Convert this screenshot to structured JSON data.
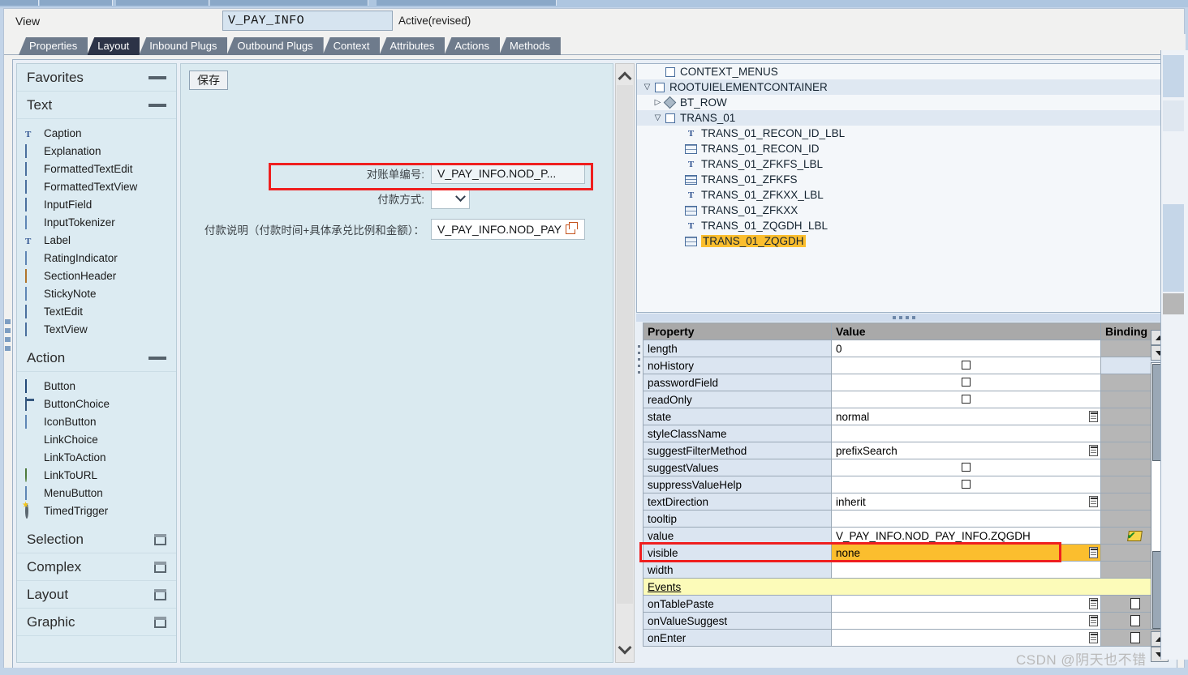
{
  "header": {
    "object_type_label": "View",
    "object_name": "V_PAY_INFO",
    "status": "Active(revised)"
  },
  "tabs": [
    {
      "label": "Properties",
      "active": false
    },
    {
      "label": "Layout",
      "active": true
    },
    {
      "label": "Inbound Plugs",
      "active": false
    },
    {
      "label": "Outbound Plugs",
      "active": false
    },
    {
      "label": "Context",
      "active": false
    },
    {
      "label": "Attributes",
      "active": false
    },
    {
      "label": "Actions",
      "active": false
    },
    {
      "label": "Methods",
      "active": false
    }
  ],
  "palette": {
    "groups": [
      {
        "title": "Favorites",
        "collapsed": false,
        "toggle": "dash",
        "items": []
      },
      {
        "title": "Text",
        "collapsed": false,
        "toggle": "dash",
        "items": [
          {
            "label": "Caption",
            "icon": "text-T-icon"
          },
          {
            "label": "Explanation",
            "icon": "explanation-icon"
          },
          {
            "label": "FormattedTextEdit",
            "icon": "formatted-text-edit-icon"
          },
          {
            "label": "FormattedTextView",
            "icon": "formatted-text-view-icon"
          },
          {
            "label": "InputField",
            "icon": "input-field-icon"
          },
          {
            "label": "InputTokenizer",
            "icon": "input-tokenizer-icon"
          },
          {
            "label": "Label",
            "icon": "label-T-icon"
          },
          {
            "label": "RatingIndicator",
            "icon": "rating-indicator-icon"
          },
          {
            "label": "SectionHeader",
            "icon": "section-header-icon"
          },
          {
            "label": "StickyNote",
            "icon": "sticky-note-icon"
          },
          {
            "label": "TextEdit",
            "icon": "text-edit-icon"
          },
          {
            "label": "TextView",
            "icon": "text-view-icon"
          }
        ]
      },
      {
        "title": "Action",
        "collapsed": false,
        "toggle": "dash",
        "items": [
          {
            "label": "Button",
            "icon": "button-icon"
          },
          {
            "label": "ButtonChoice",
            "icon": "button-choice-icon"
          },
          {
            "label": "IconButton",
            "icon": "icon-button-icon"
          },
          {
            "label": "LinkChoice",
            "icon": "link-choice-icon"
          },
          {
            "label": "LinkToAction",
            "icon": "link-to-action-icon"
          },
          {
            "label": "LinkToURL",
            "icon": "link-to-url-icon"
          },
          {
            "label": "MenuButton",
            "icon": "menu-button-icon"
          },
          {
            "label": "TimedTrigger",
            "icon": "timed-trigger-icon"
          }
        ]
      },
      {
        "title": "Selection",
        "collapsed": true,
        "toggle": "box",
        "items": []
      },
      {
        "title": "Complex",
        "collapsed": true,
        "toggle": "box",
        "items": []
      },
      {
        "title": "Layout",
        "collapsed": true,
        "toggle": "box",
        "items": []
      },
      {
        "title": "Graphic",
        "collapsed": true,
        "toggle": "box",
        "items": []
      }
    ]
  },
  "canvas": {
    "save_button": "保存",
    "fields": [
      {
        "label": "对账单编号:",
        "value": "V_PAY_INFO.NOD_P...",
        "type": "input"
      },
      {
        "label": "付款方式:",
        "value": "",
        "type": "dropdown"
      },
      {
        "label": "付款说明（付款时间+具体承兑比例和金额）：",
        "value": "V_PAY_INFO.NOD_PAY",
        "type": "input-with-help"
      }
    ]
  },
  "tree": {
    "nodes": [
      {
        "label": "CONTEXT_MENUS",
        "indent": 1,
        "twisty": "",
        "icon": "box-icon",
        "selected": false,
        "alt": false
      },
      {
        "label": "ROOTUIELEMENTCONTAINER",
        "indent": 0,
        "twisty": "▽",
        "icon": "box-icon",
        "selected": false,
        "alt": true
      },
      {
        "label": "BT_ROW",
        "indent": 1,
        "twisty": "▷",
        "icon": "diamond-icon",
        "selected": false,
        "alt": false
      },
      {
        "label": "TRANS_01",
        "indent": 1,
        "twisty": "▽",
        "icon": "box-icon",
        "selected": false,
        "alt": true
      },
      {
        "label": "TRANS_01_RECON_ID_LBL",
        "indent": 3,
        "twisty": "",
        "icon": "label-T-icon",
        "selected": false,
        "alt": false
      },
      {
        "label": "TRANS_01_RECON_ID",
        "indent": 3,
        "twisty": "",
        "icon": "input-field-icon",
        "selected": false,
        "alt": false
      },
      {
        "label": "TRANS_01_ZFKFS_LBL",
        "indent": 3,
        "twisty": "",
        "icon": "label-T-icon",
        "selected": false,
        "alt": false
      },
      {
        "label": "TRANS_01_ZFKFS",
        "indent": 3,
        "twisty": "",
        "icon": "dropdown-field-icon",
        "selected": false,
        "alt": false
      },
      {
        "label": "TRANS_01_ZFKXX_LBL",
        "indent": 3,
        "twisty": "",
        "icon": "label-T-icon",
        "selected": false,
        "alt": false
      },
      {
        "label": "TRANS_01_ZFKXX",
        "indent": 3,
        "twisty": "",
        "icon": "input-field-icon",
        "selected": false,
        "alt": false
      },
      {
        "label": "TRANS_01_ZQGDH_LBL",
        "indent": 3,
        "twisty": "",
        "icon": "label-T-icon",
        "selected": false,
        "alt": false
      },
      {
        "label": "TRANS_01_ZQGDH",
        "indent": 3,
        "twisty": "",
        "icon": "input-field-icon",
        "selected": true,
        "alt": false
      }
    ]
  },
  "properties": {
    "columns": [
      "Property",
      "Value",
      "Binding"
    ],
    "rows": [
      {
        "name": "length",
        "value": "0",
        "kind": "text",
        "binding": "filled",
        "valuehelp": false
      },
      {
        "name": "noHistory",
        "value": "",
        "kind": "checkbox",
        "binding": "empty",
        "valuehelp": false
      },
      {
        "name": "passwordField",
        "value": "",
        "kind": "checkbox",
        "binding": "filled",
        "valuehelp": false
      },
      {
        "name": "readOnly",
        "value": "",
        "kind": "checkbox",
        "binding": "filled",
        "valuehelp": false
      },
      {
        "name": "state",
        "value": "normal",
        "kind": "text",
        "binding": "filled",
        "valuehelp": true
      },
      {
        "name": "styleClassName",
        "value": "",
        "kind": "text",
        "binding": "filled",
        "valuehelp": false
      },
      {
        "name": "suggestFilterMethod",
        "value": "prefixSearch",
        "kind": "text",
        "binding": "filled",
        "valuehelp": true
      },
      {
        "name": "suggestValues",
        "value": "",
        "kind": "checkbox",
        "binding": "filled",
        "valuehelp": false
      },
      {
        "name": "suppressValueHelp",
        "value": "",
        "kind": "checkbox",
        "binding": "filled",
        "valuehelp": false
      },
      {
        "name": "textDirection",
        "value": "inherit",
        "kind": "text",
        "binding": "filled",
        "valuehelp": true
      },
      {
        "name": "tooltip",
        "value": "",
        "kind": "text",
        "binding": "filled",
        "valuehelp": false
      },
      {
        "name": "value",
        "value": "V_PAY_INFO.NOD_PAY_INFO.ZQGDH",
        "kind": "text",
        "binding": "bound-icon",
        "valuehelp": false
      },
      {
        "name": "visible",
        "value": "none",
        "kind": "text",
        "binding": "filled",
        "valuehelp": true,
        "highlighted": true
      },
      {
        "name": "width",
        "value": "",
        "kind": "text",
        "binding": "filled",
        "valuehelp": false
      }
    ],
    "events_header": "Events",
    "event_rows": [
      {
        "name": "onTablePaste",
        "value": "",
        "binding": "page",
        "valuehelp": true
      },
      {
        "name": "onValueSuggest",
        "value": "",
        "binding": "page",
        "valuehelp": true
      },
      {
        "name": "onEnter",
        "value": "",
        "binding": "page",
        "valuehelp": true
      }
    ]
  },
  "watermark": "CSDN @阴天也不错",
  "colors": {
    "highlight_yellow": "#fbbe2e",
    "annotation_red": "#ef1f1f",
    "active_tab": "#2c3347",
    "canvas_bg": "#daeaf0",
    "palette_bg": "#dcebf2",
    "events_bg": "#fcfbb9"
  }
}
